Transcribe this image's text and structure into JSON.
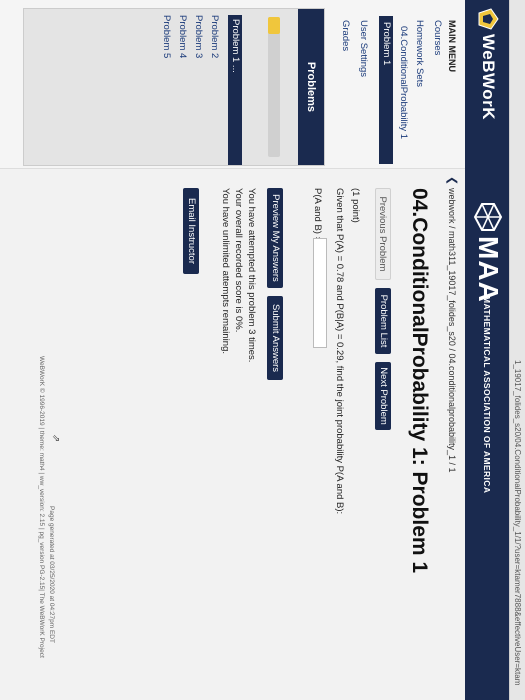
{
  "browser": {
    "url": "1_19017_folides_s20/04.ConditionalProbability_1/1/?user=ktamer7888&effectiveUser=ktam"
  },
  "header": {
    "app_name": "WeBWorK",
    "brand": "MAA",
    "brand_sub": "MATHEMATICAL ASSOCIATION OF AMERICA"
  },
  "sidebar": {
    "main_menu": "MAIN MENU",
    "courses": "Courses",
    "homework_sets": "Homework Sets",
    "set_name": "04.ConditionalProbability 1",
    "problem_active": "Problem 1",
    "user_settings": "User Settings",
    "grades": "Grades"
  },
  "problems_panel": {
    "title": "Problems",
    "progress_fraction": 0.12,
    "items": [
      "Problem 1 ...",
      "Problem 2",
      "Problem 3",
      "Problem 4",
      "Problem 5"
    ]
  },
  "main": {
    "breadcrumb": "webwork / math311_19017_folides_s20 / 04.conditionalprobability_1 / 1",
    "title": "04.ConditionalProbability 1: Problem 1",
    "prev_button": "Previous Problem",
    "list_button": "Problem List",
    "next_button": "Next Problem",
    "points": "(1 point)",
    "question": "Given that P(A) = 0.78 and P(B|A) = 0.29, find the joint probability P(A and B):",
    "answer_label": "P(A and B) =",
    "answer_value": "",
    "preview_button": "Preview My Answers",
    "submit_button": "Submit Answers",
    "status": [
      "You have attempted this problem 3 times.",
      "Your overall recorded score is 0%.",
      "You have unlimited attempts remaining."
    ],
    "email_button": "Email Instructor"
  },
  "footer": {
    "generated": "Page generated at 03/25/2020 at 04:27pm EDT",
    "version": "WeBWorK © 1996-2019 | theme: math4 | ww_version: 2.15 | pg_version PG-2.15| The WeBWorK Project"
  },
  "colors": {
    "header_bg": "#1a2a4f",
    "progress": "#f0c63c",
    "page_bg": "#f2f2f2"
  }
}
